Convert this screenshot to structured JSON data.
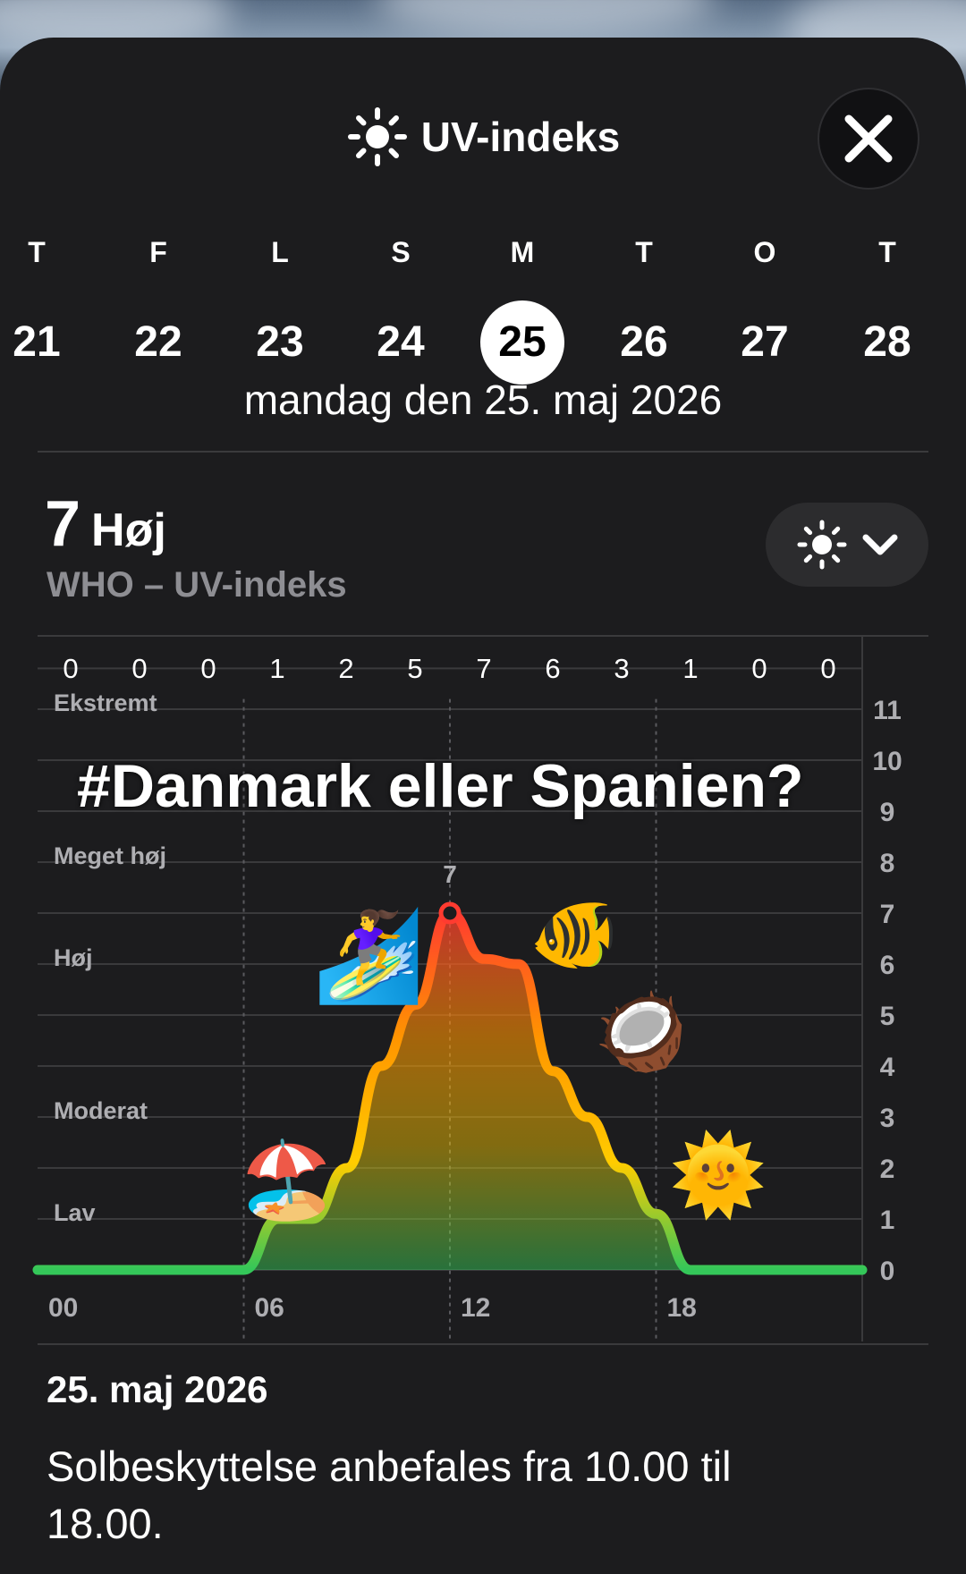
{
  "header": {
    "title": "UV-indeks",
    "sun_icon": "sun-icon",
    "close_icon": "close-icon"
  },
  "days": [
    {
      "letter": "T",
      "num": "21",
      "selected": false
    },
    {
      "letter": "F",
      "num": "22",
      "selected": false
    },
    {
      "letter": "L",
      "num": "23",
      "selected": false
    },
    {
      "letter": "S",
      "num": "24",
      "selected": false
    },
    {
      "letter": "M",
      "num": "25",
      "selected": true
    },
    {
      "letter": "T",
      "num": "26",
      "selected": false
    },
    {
      "letter": "O",
      "num": "27",
      "selected": false
    },
    {
      "letter": "T",
      "num": "28",
      "selected": false
    }
  ],
  "date_line": "mandag den 25. maj 2026",
  "current": {
    "value": "7",
    "category": "Høj",
    "scale_name": "WHO – UV-indeks"
  },
  "layer_button": {
    "icon": "sun-icon",
    "chevron": "chevron-down-icon"
  },
  "chart_data": {
    "type": "area",
    "hourly_labels": [
      "0",
      "0",
      "0",
      "1",
      "2",
      "5",
      "7",
      "6",
      "3",
      "1",
      "0",
      "0"
    ],
    "x_ticks": [
      "00",
      "06",
      "12",
      "18"
    ],
    "y_ticks": [
      "0",
      "1",
      "2",
      "3",
      "4",
      "5",
      "6",
      "7",
      "8",
      "9",
      "10",
      "11"
    ],
    "ylim": [
      0,
      11
    ],
    "xlim": [
      0,
      24
    ],
    "bands": [
      {
        "label": "Ekstremt",
        "at": 11
      },
      {
        "label": "Meget høj",
        "at": 8
      },
      {
        "label": "Høj",
        "at": 6
      },
      {
        "label": "Moderat",
        "at": 3
      },
      {
        "label": "Lav",
        "at": 1
      }
    ],
    "peak_label": "7",
    "x": [
      0,
      6,
      7,
      8,
      9,
      10,
      11,
      12,
      13,
      14,
      15,
      16,
      17,
      18,
      19,
      20,
      21,
      22,
      23,
      24
    ],
    "y": [
      0,
      0,
      1,
      1,
      2,
      4,
      5.2,
      7,
      6.1,
      6,
      3.9,
      3,
      2,
      1.1,
      0,
      0,
      0,
      0,
      0,
      0
    ],
    "colors": {
      "low": "#34c759",
      "moderate": "#ffcc00",
      "high": "#ff9500",
      "very_high": "#ff3b30"
    }
  },
  "overlay_text": "#Danmark eller Spanien?",
  "stickers": [
    "🏄‍♀️",
    "🐠",
    "🥥",
    "🌞",
    "🏖️"
  ],
  "footer": {
    "date": "25. maj 2026",
    "advice": "Solbeskyttelse anbefales fra 10.00 til 18.00."
  }
}
